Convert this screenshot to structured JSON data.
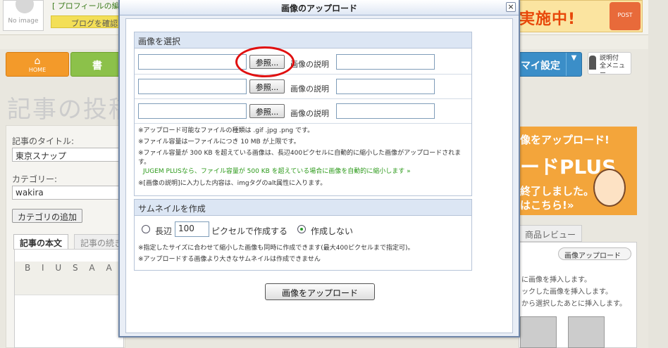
{
  "background": {
    "avatar_text": "No image",
    "profile_link": "[ プロフィールの編",
    "blog_confirm": "ブログを確認",
    "campaign_text": "実施中!",
    "home_label": "HOME",
    "write_label": "書",
    "myset_label": "マイ設定",
    "help_label_1": "説明付",
    "help_label_2": "全メニュー",
    "page_title": "記事の投稿",
    "title_label": "記事のタイトル:",
    "title_value": "東京スナップ",
    "category_label": "カテゴリー:",
    "category_value": "wakira",
    "add_category": "カテゴリの追加",
    "tab_body": "記事の本文",
    "tab_continue": "記事の続き",
    "toolbar_text": "B I U S A A",
    "ad_line1": "像をアップロード!",
    "ad_line2": "ードPLUS",
    "ad_line3": "終了しました。",
    "ad_line4": "はこちら!»",
    "review_tab": "商品レビュー",
    "upload_small_btn": "画像アップロード",
    "review_text_1": "に画像を挿入します。",
    "review_text_2": "ックした画像を挿入します。",
    "review_text_3": "から選択したあとに挿入します。"
  },
  "modal": {
    "title": "画像のアップロード",
    "close": "×",
    "select_section": "画像を選択",
    "browse_label": "参照...",
    "desc_label": "画像の説明",
    "note_1": "※アップロード可能なファイルの種類は .gif .jpg .png です。",
    "note_2": "※ファイル容量は一ファイルにつき 10 MB が上限です。",
    "note_3": "※ファイル容量が 300 KB を超えている画像は、長辺400ピクセルに自動的に縮小した画像がアップロードされます。",
    "note_4": "JUGEM PLUSなら、ファイル容量が 500 KB を超えている場合に画像を自動的に縮小します »",
    "note_5": "※[画像の説明]に入力した内容は、imgタグのalt属性に入ります。",
    "thumb_section": "サムネイルを作成",
    "long_side_label": "長辺",
    "long_side_value": "100",
    "pixel_label": "ピクセルで作成する",
    "no_create_label": "作成しない",
    "thumb_note_1": "※指定したサイズに合わせて縮小した画像も同時に作成できます(最大400ピクセルまで指定可)。",
    "thumb_note_2": "※アップロードする画像より大きなサムネイルは作成できません",
    "submit_label": "画像をアップロード"
  },
  "colors": {
    "annotation_circle": "#e01010",
    "section_header": "#dce6f4",
    "link_green": "#2c9a1a"
  }
}
